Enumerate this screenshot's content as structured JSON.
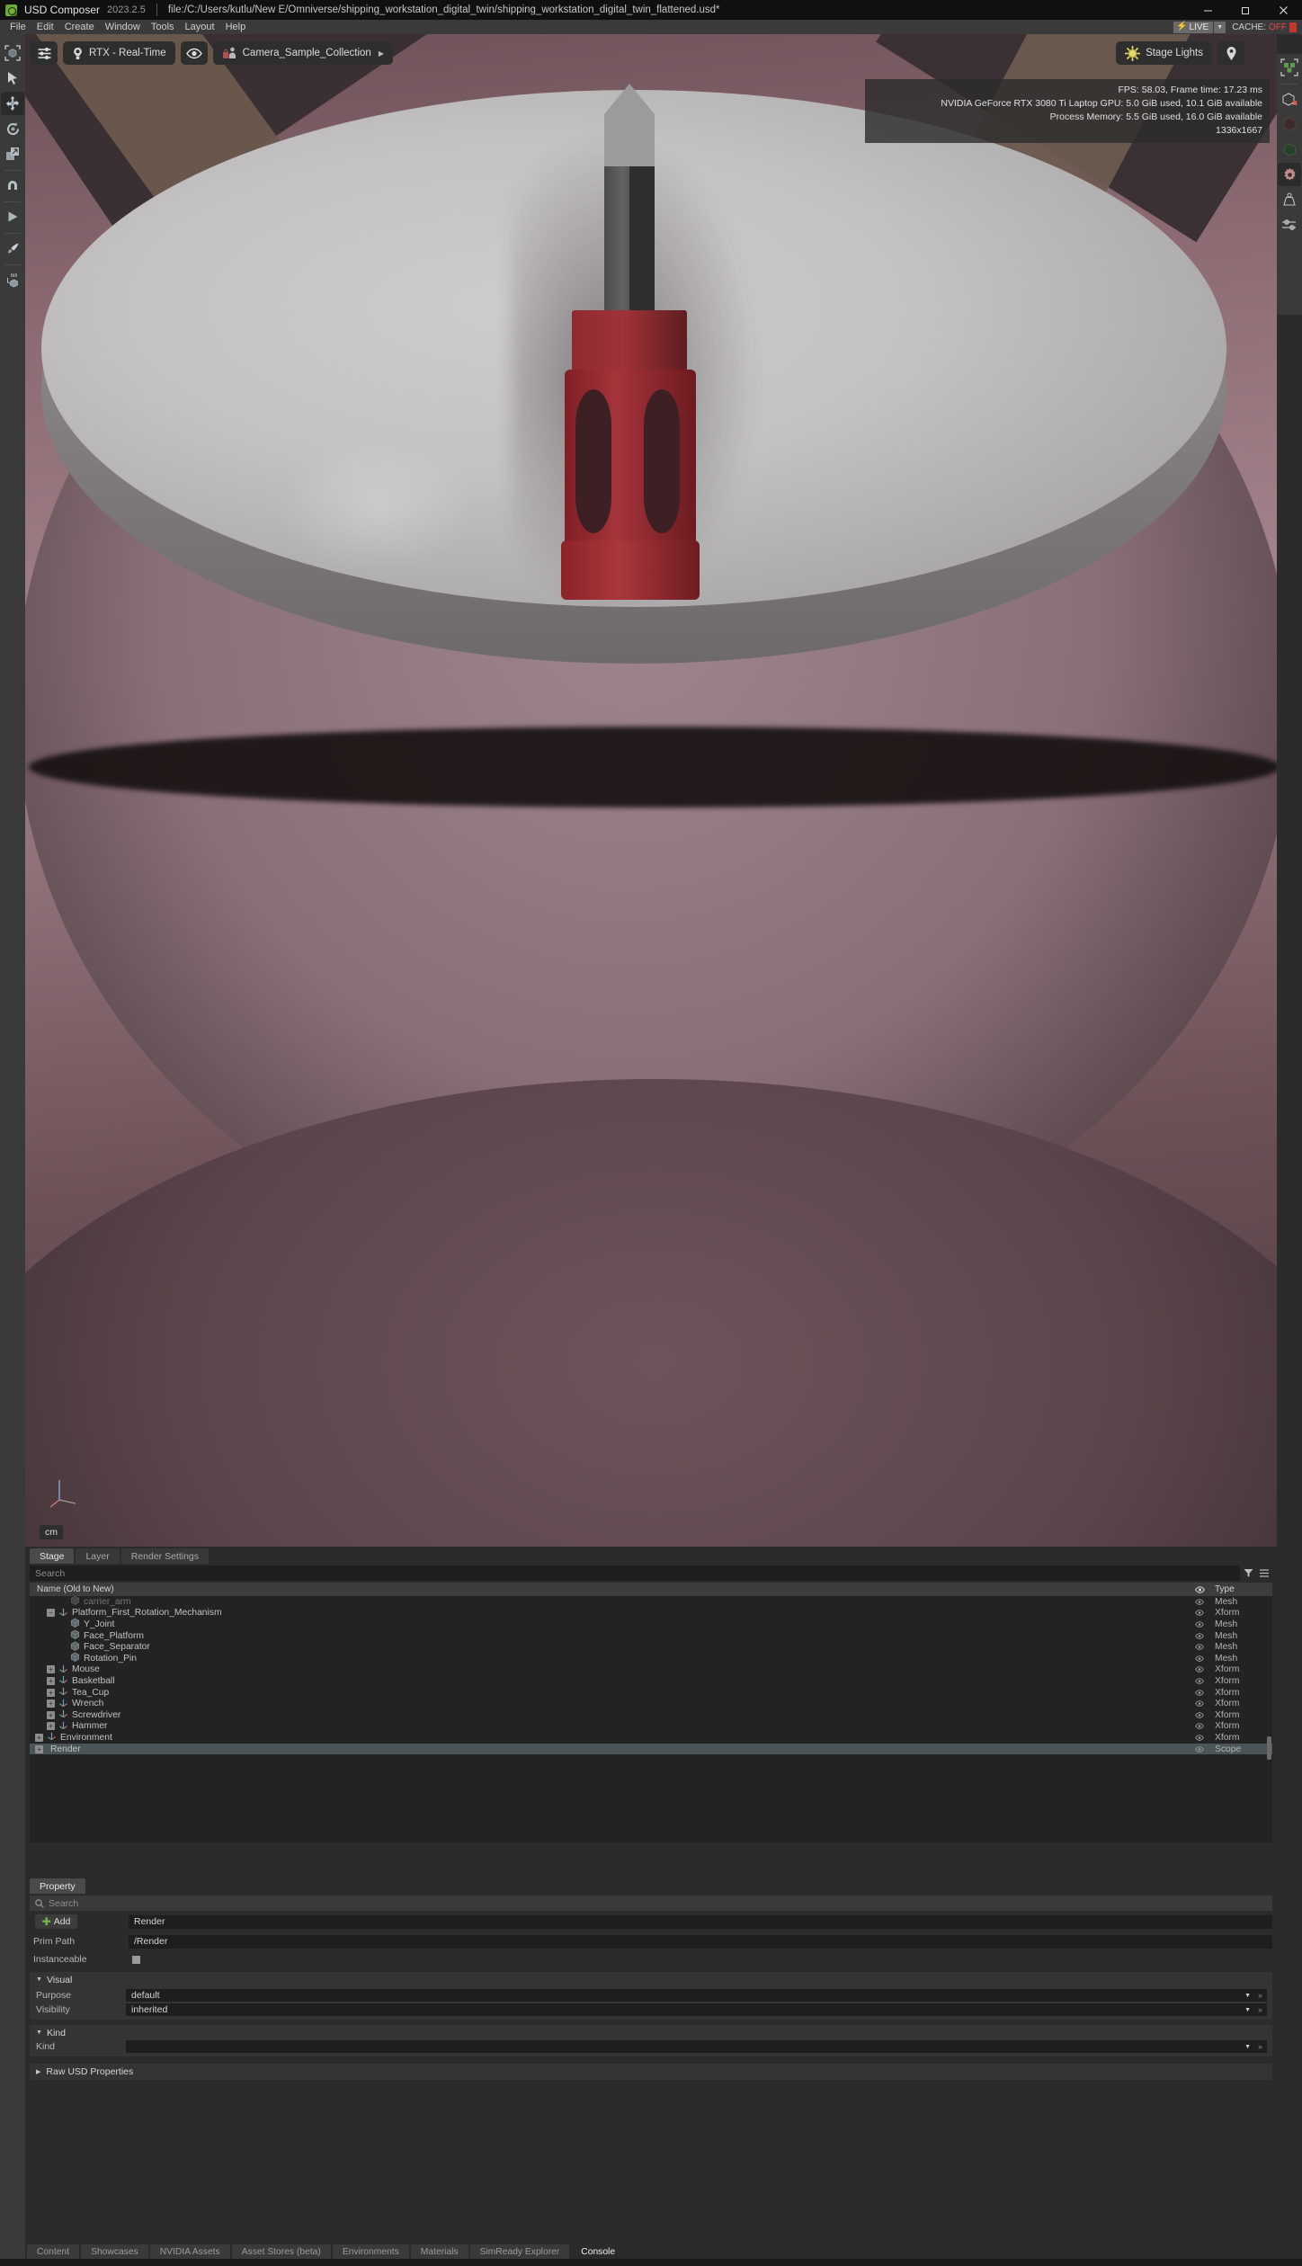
{
  "titlebar": {
    "app_name": "USD Composer",
    "version": "2023.2.5",
    "file_path": "file:/C:/Users/kutlu/New E/Omniverse/shipping_workstation_digital_twin/shipping_workstation_digital_twin_flattened.usd*",
    "logo_icon": "omniverse-logo-icon",
    "minimize_label": "minimize-icon",
    "maximize_label": "maximize-icon",
    "close_label": "close-icon"
  },
  "menubar": {
    "items": [
      "File",
      "Edit",
      "Create",
      "Window",
      "Tools",
      "Layout",
      "Help"
    ]
  },
  "livebar": {
    "live_label": "LIVE",
    "bolt_icon": "bolt-icon",
    "caret_icon": "chevron-down-icon",
    "cache_label": "CACHE:",
    "cache_value": "OFF",
    "cache_icon": "cache-doc-icon",
    "live_color": "#ffd400",
    "cache_off_color": "#e04a4a"
  },
  "left_rail": {
    "items": [
      {
        "name": "select-bounds-icon",
        "active": false
      },
      {
        "name": "cursor-select-icon",
        "active": false
      },
      {
        "name": "move-tool-icon",
        "active": true
      },
      {
        "name": "rotate-tool-icon",
        "active": false
      },
      {
        "name": "scale-tool-icon",
        "active": false
      },
      {
        "name": "snap-magnet-icon",
        "active": false
      },
      {
        "name": "play-animation-icon",
        "active": false
      },
      {
        "name": "paint-brush-icon",
        "active": false
      },
      {
        "name": "physics-drop-icon",
        "active": false
      }
    ]
  },
  "right_rail": {
    "items": [
      {
        "name": "selection-cubes-icon",
        "active": false
      },
      {
        "name": "hide-unselected-icon",
        "active": false
      },
      {
        "name": "dark-cube-icon",
        "active": false
      },
      {
        "name": "green-cube-icon",
        "active": false
      },
      {
        "name": "physics-settings-gear-icon",
        "active": true
      },
      {
        "name": "mass-weight-icon",
        "active": false
      },
      {
        "name": "sliders-settings-icon",
        "active": false
      }
    ]
  },
  "viewport": {
    "toolbar_left": [
      {
        "name": "viewport-settings-icon",
        "label": "",
        "icon": "sliders-icon"
      },
      {
        "name": "render-mode-dropdown",
        "label": "RTX - Real-Time",
        "icon": "lightbulb-icon"
      },
      {
        "name": "visibility-eye-icon",
        "label": "",
        "icon": "eye-icon"
      },
      {
        "name": "camera-dropdown",
        "label": "Camera_Sample_Collection",
        "icon": "camera-lock-icon"
      }
    ],
    "toolbar_right": [
      {
        "name": "stage-lights-dropdown",
        "label": "Stage Lights",
        "icon": "sun-icon"
      },
      {
        "name": "viewport-marker-icon",
        "label": "",
        "icon": "map-pin-icon"
      }
    ],
    "hud": {
      "line1": "FPS: 58.03, Frame time: 17.23 ms",
      "line2": "NVIDIA GeForce RTX 3080 Ti Laptop GPU: 5.0 GiB used, 10.1 GiB available",
      "line3": "Process Memory: 5.5 GiB used, 16.0 GiB available",
      "line4": "1336x1667"
    },
    "unit_chip": "cm",
    "axis_gizmo_icon": "axis-gizmo-icon"
  },
  "stage_panel": {
    "tabs": [
      {
        "label": "Stage",
        "active": true
      },
      {
        "label": "Layer",
        "active": false
      },
      {
        "label": "Render Settings",
        "active": false
      }
    ],
    "search_placeholder": "Search",
    "filter_icon": "filter-icon",
    "options_icon": "list-options-icon",
    "columns": {
      "name": "Name (Old to New)",
      "type": "Type"
    },
    "rows": [
      {
        "label": "carrier_arm",
        "type": "Mesh",
        "indent": 3,
        "expander": "none",
        "icon": "mesh-icon",
        "clipped": true,
        "selected": false
      },
      {
        "label": "Platform_First_Rotation_Mechanism",
        "type": "Xform",
        "indent": 2,
        "expander": "minus",
        "icon": "xform-icon",
        "selected": false
      },
      {
        "label": "Y_Joint",
        "type": "Mesh",
        "indent": 3,
        "expander": "none",
        "icon": "mesh-icon",
        "selected": false
      },
      {
        "label": "Face_Platform",
        "type": "Mesh",
        "indent": 3,
        "expander": "none",
        "icon": "mesh-icon",
        "selected": false
      },
      {
        "label": "Face_Separator",
        "type": "Mesh",
        "indent": 3,
        "expander": "none",
        "icon": "mesh-icon",
        "selected": false
      },
      {
        "label": "Rotation_Pin",
        "type": "Mesh",
        "indent": 3,
        "expander": "none",
        "icon": "mesh-icon",
        "selected": false
      },
      {
        "label": "Mouse",
        "type": "Xform",
        "indent": 2,
        "expander": "plus",
        "icon": "xform-icon",
        "selected": false
      },
      {
        "label": "Basketball",
        "type": "Xform",
        "indent": 2,
        "expander": "plus",
        "icon": "xform-icon",
        "selected": false
      },
      {
        "label": "Tea_Cup",
        "type": "Xform",
        "indent": 2,
        "expander": "plus",
        "icon": "xform-icon",
        "selected": false
      },
      {
        "label": "Wrench",
        "type": "Xform",
        "indent": 2,
        "expander": "plus",
        "icon": "xform-icon",
        "selected": false
      },
      {
        "label": "Screwdriver",
        "type": "Xform",
        "indent": 2,
        "expander": "plus",
        "icon": "xform-icon",
        "selected": false
      },
      {
        "label": "Hammer",
        "type": "Xform",
        "indent": 2,
        "expander": "plus",
        "icon": "xform-icon",
        "selected": false
      },
      {
        "label": "Environment",
        "type": "Xform",
        "indent": 1,
        "expander": "plus",
        "icon": "xform-icon",
        "selected": false
      },
      {
        "label": "Render",
        "type": "Scope",
        "indent": 1,
        "expander": "plus",
        "icon": "scope-icon",
        "selected": true
      }
    ]
  },
  "property_panel": {
    "tab_label": "Property",
    "search_placeholder": "Search",
    "search_icon": "search-icon",
    "add_label": "Add",
    "add_icon": "plus-icon",
    "name_value": "Render",
    "prim_path_label": "Prim Path",
    "prim_path_value": "/Render",
    "instanceable_label": "Instanceable",
    "instanceable_checked": false,
    "sections": [
      {
        "title": "Visual",
        "expanded": true,
        "rows": [
          {
            "label": "Purpose",
            "value": "default",
            "type": "combo"
          },
          {
            "label": "Visibility",
            "value": "inherited",
            "type": "combo"
          }
        ]
      },
      {
        "title": "Kind",
        "expanded": true,
        "rows": [
          {
            "label": "Kind",
            "value": "",
            "type": "combo"
          }
        ]
      }
    ],
    "raw_usd_label": "Raw USD Properties",
    "raw_usd_expanded": false
  },
  "bottom_tabs": [
    {
      "label": "Content",
      "active": false
    },
    {
      "label": "Showcases",
      "active": false
    },
    {
      "label": "NVIDIA Assets",
      "active": false
    },
    {
      "label": "Asset Stores (beta)",
      "active": false
    },
    {
      "label": "Environments",
      "active": false
    },
    {
      "label": "Materials",
      "active": false
    },
    {
      "label": "SimReady Explorer",
      "active": false
    },
    {
      "label": "Console",
      "active": true
    }
  ]
}
